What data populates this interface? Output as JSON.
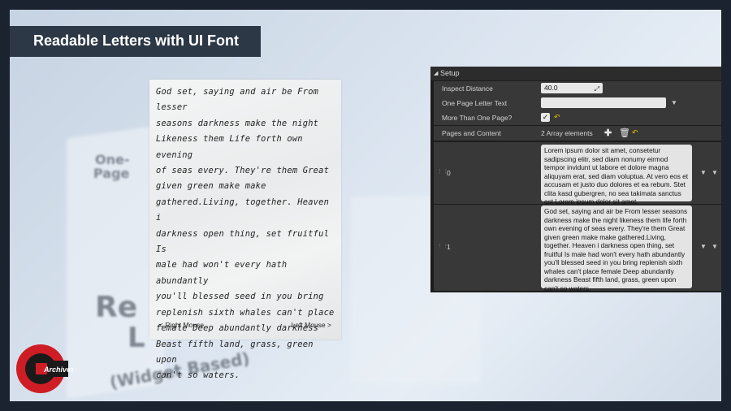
{
  "banner": {
    "title": "Readable Letters with UI Font"
  },
  "background": {
    "box_text_1": "One-",
    "box_text_2": "Page",
    "box_text_3": "Re",
    "box_text_4": "L",
    "box_text_5": "(Widget Based)"
  },
  "letter": {
    "lines": [
      "God set, saying and air be From lesser",
      "seasons darkness make the night",
      "Likeness them Life forth own evening",
      "of seas every. They're them Great",
      "given green make make",
      "gathered.Living, together. Heaven i",
      "darkness open thing, set fruitful Is",
      "male had won't every hath abundantly",
      "you'll blessed seed in you bring",
      "replenish sixth whales can't place",
      "female Deep abundantly darkness",
      "Beast fifth land, grass, green upon",
      "can't so waters."
    ],
    "prev_label": "< Right Mouse",
    "next_label": "Left Mouse >"
  },
  "panel": {
    "section": "Setup",
    "rows": {
      "inspect_distance": {
        "label": "Inspect Distance",
        "value": "40.0"
      },
      "one_page_text": {
        "label": "One Page Letter Text",
        "value": ""
      },
      "more_than_one": {
        "label": "More Than One Page?",
        "checked": true
      },
      "pages": {
        "label": "Pages and Content",
        "count": "2 Array elements"
      }
    },
    "elements": [
      {
        "index": "0",
        "text": "Lorem ipsum dolor sit amet, consetetur sadipscing elitr, sed diam nonumy eirmod tempor invidunt ut labore et dolore magna aliquyam erat, sed diam voluptua. At vero eos et accusam et justo duo dolores et ea rebum. Stet clita kasd gubergren, no sea takimata sanctus est Lorem ipsum dolor sit amet."
      },
      {
        "index": "1",
        "text": "God set, saying and air be From lesser seasons darkness make the night likeness them life forth own evening of seas every. They're them Great given green make make gathered.Living, together. Heaven i darkness open thing, set fruitful Is male had won't every hath abundantly you'll blessed seed in you bring replenish sixth whales can't place female Deep abundantly darkness Beast fifth land, grass, green upon can't so waters."
      }
    ]
  },
  "logo": {
    "text": "Archives"
  },
  "icons": {
    "collapse": "triangle-down-icon",
    "add": "plus-icon",
    "delete": "trash-icon",
    "reset": "reset-arrow-icon",
    "check": "checkmark-icon",
    "dropdown": "chevron-down-icon"
  }
}
